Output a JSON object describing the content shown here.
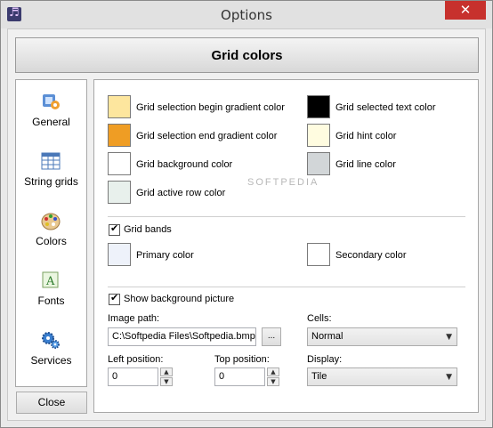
{
  "window": {
    "title": "Options",
    "close_glyph": "✕"
  },
  "header": {
    "title": "Grid colors"
  },
  "sidebar": {
    "items": [
      {
        "label": "General",
        "icon": "general-icon"
      },
      {
        "label": "String grids",
        "icon": "grid-icon"
      },
      {
        "label": "Colors",
        "icon": "palette-icon"
      },
      {
        "label": "Fonts",
        "icon": "font-icon"
      },
      {
        "label": "Services",
        "icon": "gears-icon"
      }
    ],
    "close_label": "Close"
  },
  "colors": [
    {
      "label": "Grid selection begin gradient color",
      "color": "#fde69e"
    },
    {
      "label": "Grid selection end gradient color",
      "color": "#ef9d24"
    },
    {
      "label": "Grid background color",
      "color": "#ffffff"
    },
    {
      "label": "Grid active row color",
      "color": "#e8f0ec"
    },
    {
      "label": "Grid selected text color",
      "color": "#000000"
    },
    {
      "label": "Grid hint color",
      "color": "#fffce0"
    },
    {
      "label": "Grid line color",
      "color": "#d2d6d8"
    }
  ],
  "bands": {
    "label": "Grid bands",
    "checked": true,
    "primary": {
      "label": "Primary color",
      "color": "#eef2fa"
    },
    "secondary": {
      "label": "Secondary color",
      "color": "#ffffff"
    }
  },
  "background": {
    "label": "Show background picture",
    "checked": true,
    "image_path_label": "Image path:",
    "image_path_value": "C:\\Softpedia Files\\Softpedia.bmp",
    "browse_label": "...",
    "cells_label": "Cells:",
    "cells_value": "Normal",
    "left_label": "Left position:",
    "left_value": "0",
    "top_label": "Top position:",
    "top_value": "0",
    "display_label": "Display:",
    "display_value": "Tile"
  },
  "watermark": "SOFTPEDIA"
}
